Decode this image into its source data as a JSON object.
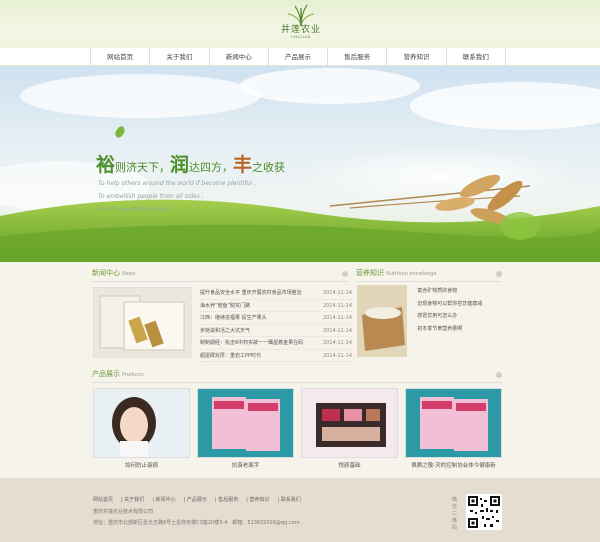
{
  "logo": {
    "text": "井莲农业",
    "sub": "JINGLIAN"
  },
  "nav": [
    "网站首页",
    "关于我们",
    "新闻中心",
    "产品展示",
    "售后服务",
    "营养知识",
    "联系我们"
  ],
  "banner": {
    "slogan_parts": [
      {
        "text": "裕",
        "big": true,
        "brown": false
      },
      {
        "text": "则济天下，",
        "big": false,
        "brown": false
      },
      {
        "text": "润",
        "big": true,
        "brown": false
      },
      {
        "text": "达四方，",
        "big": false,
        "brown": false
      },
      {
        "text": "丰",
        "big": true,
        "brown": true
      },
      {
        "text": "之收获",
        "big": false,
        "brown": false
      }
    ],
    "eng1": "To help others around the world if become plentiful ,",
    "eng2": "To embellish people from all sides ,",
    "eng3": "To rich people's harvest"
  },
  "news": {
    "title": "新闻中心",
    "title_en": "News",
    "items": [
      {
        "title": "提升食品安全水平 重庆开展农村食品市场整治",
        "date": "2014-11-14"
      },
      {
        "title": "海水养“鲍鱼”脱贫门路",
        "date": "2014-11-14"
      },
      {
        "title": "江西：继续造福果 投生产果头",
        "date": "2014-11-14"
      },
      {
        "title": "步她说和活之大坑天气",
        "date": "2014-11-14"
      },
      {
        "title": "制制期经：执击6中药实破一一鹰屋着金果在码",
        "date": "2014-11-14"
      },
      {
        "title": "超屋碟兆厚：重岩工PP时代",
        "date": "2014-11-14"
      }
    ]
  },
  "knowledge": {
    "title": "营养知识",
    "title_en": "Nutrition knowledge",
    "items": [
      "富含矿物质的食物",
      "迈现食物可以帮你控饮健康减",
      "感冒饮用可怎么办",
      "初冬季节黄营养蘑啊"
    ]
  },
  "products": {
    "title": "产品展示",
    "title_en": "Products",
    "items": [
      "如何防止衰病",
      "抗衰老面字",
      "悦颜基础",
      "佩颗之敬-河的控制协会体今健康新"
    ]
  },
  "footer": {
    "links": [
      "网站首页",
      "关于我们",
      "新闻中心",
      "产品展示",
      "售后服务",
      "营养知识",
      "联系我们"
    ],
    "company": "重庆井莲农业技术有限公司",
    "address": "地址：重庆市北部新区星光五路8号土星商务楼C3座20楼3-4　邮箱：513632026@qq.com",
    "qr_label": "微信二维码"
  },
  "colors": {
    "accent": "#6e9a3e",
    "nav_bg": "#ffffff",
    "footer_bg": "#e6ddd1"
  }
}
